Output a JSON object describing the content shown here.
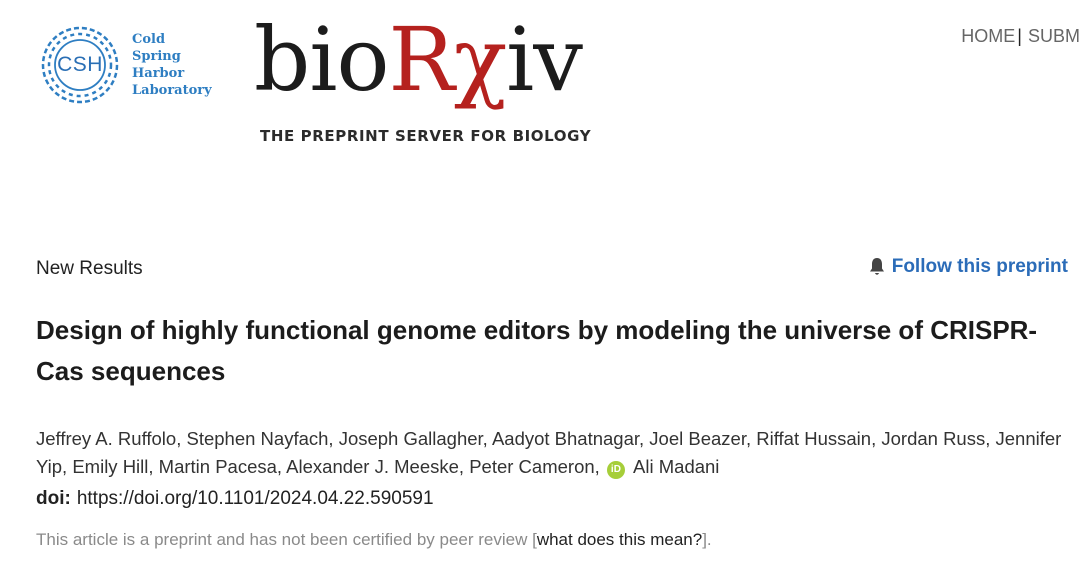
{
  "header": {
    "csh_logo": {
      "abbr": "CSH",
      "lines": [
        "Cold",
        "Spring",
        "Harbor",
        "Laboratory"
      ]
    },
    "brand": {
      "name_left": "bio",
      "name_rx": "Rχ",
      "name_right": "iv",
      "tagline": "THE PREPRINT SERVER FOR BIOLOGY"
    },
    "nav": {
      "home": "HOME",
      "separator": "|",
      "submit": "SUBM"
    }
  },
  "article": {
    "status": "New Results",
    "follow": {
      "icon": "bell-icon",
      "label": "Follow this preprint"
    },
    "title": "Design of highly functional genome editors by modeling the universe of CRISPR-Cas sequences",
    "authors_before_orcid": "Jeffrey A. Ruffolo, Stephen Nayfach, Joseph Gallagher, Aadyot Bhatnagar, Joel Beazer, Riffat Hussain, Jordan Russ, Jennifer Yip, Emily Hill, Martin Pacesa, Alexander J. Meeske, Peter Cameron,",
    "orcid_glyph": "iD",
    "last_author": "Ali Madani",
    "doi_label": "doi:",
    "doi_url": "https://doi.org/10.1101/2024.04.22.590591",
    "notice": {
      "text": "This article is a preprint and has not been certified by peer review [",
      "link": "what does this mean?",
      "suffix": "]."
    }
  },
  "colors": {
    "accent_blue": "#2b6cb8",
    "brand_red": "#b5211e",
    "csh_blue": "#2e7ec2",
    "orcid_green": "#a6ce39"
  }
}
